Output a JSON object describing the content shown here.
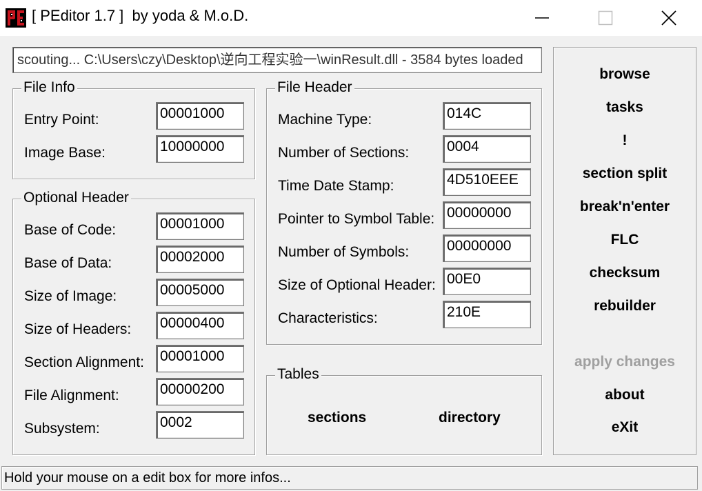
{
  "window": {
    "title": "[ PEditor 1.7 ]  by yoda & M.o.D."
  },
  "path": "scouting... C:\\Users\\czy\\Desktop\\逆向工程实验一\\winResult.dll - 3584 bytes loaded",
  "file_info": {
    "title": "File Info",
    "fields": [
      {
        "label": "Entry Point:",
        "value": "00001000"
      },
      {
        "label": "Image Base:",
        "value": "10000000"
      }
    ]
  },
  "optional_header": {
    "title": "Optional Header",
    "fields": [
      {
        "label": "Base of Code:",
        "value": "00001000"
      },
      {
        "label": "Base of Data:",
        "value": "00002000"
      },
      {
        "label": "Size of Image:",
        "value": "00005000"
      },
      {
        "label": "Size of Headers:",
        "value": "00000400"
      },
      {
        "label": "Section Alignment:",
        "value": "00001000"
      },
      {
        "label": "File Alignment:",
        "value": "00000200"
      },
      {
        "label": "Subsystem:",
        "value": "0002"
      }
    ]
  },
  "file_header": {
    "title": "File Header",
    "fields": [
      {
        "label": "Machine Type:",
        "value": "014C"
      },
      {
        "label": "Number of Sections:",
        "value": "0004"
      },
      {
        "label": "Time Date Stamp:",
        "value": "4D510EEE"
      },
      {
        "label": "Pointer to Symbol Table:",
        "value": "00000000"
      },
      {
        "label": "Number of Symbols:",
        "value": "00000000"
      },
      {
        "label": "Size of Optional Header:",
        "value": "00E0"
      },
      {
        "label": "Characteristics:",
        "value": "210E"
      }
    ]
  },
  "tables": {
    "title": "Tables",
    "sections_label": "sections",
    "directory_label": "directory"
  },
  "side_panel": {
    "browse": "browse",
    "tasks": "tasks",
    "bang": "!",
    "section_split": "section split",
    "break_n_enter": "break'n'enter",
    "flc": "FLC",
    "checksum": "checksum",
    "rebuilder": "rebuilder",
    "apply_changes": "apply changes",
    "about": "about",
    "exit": "eXit"
  },
  "status": "Hold your mouse on a edit box for more infos...",
  "colors": {
    "window_bg": "#f0f0f0",
    "disabled_text": "#a0a0a0",
    "icon_red": "#c8141e"
  }
}
